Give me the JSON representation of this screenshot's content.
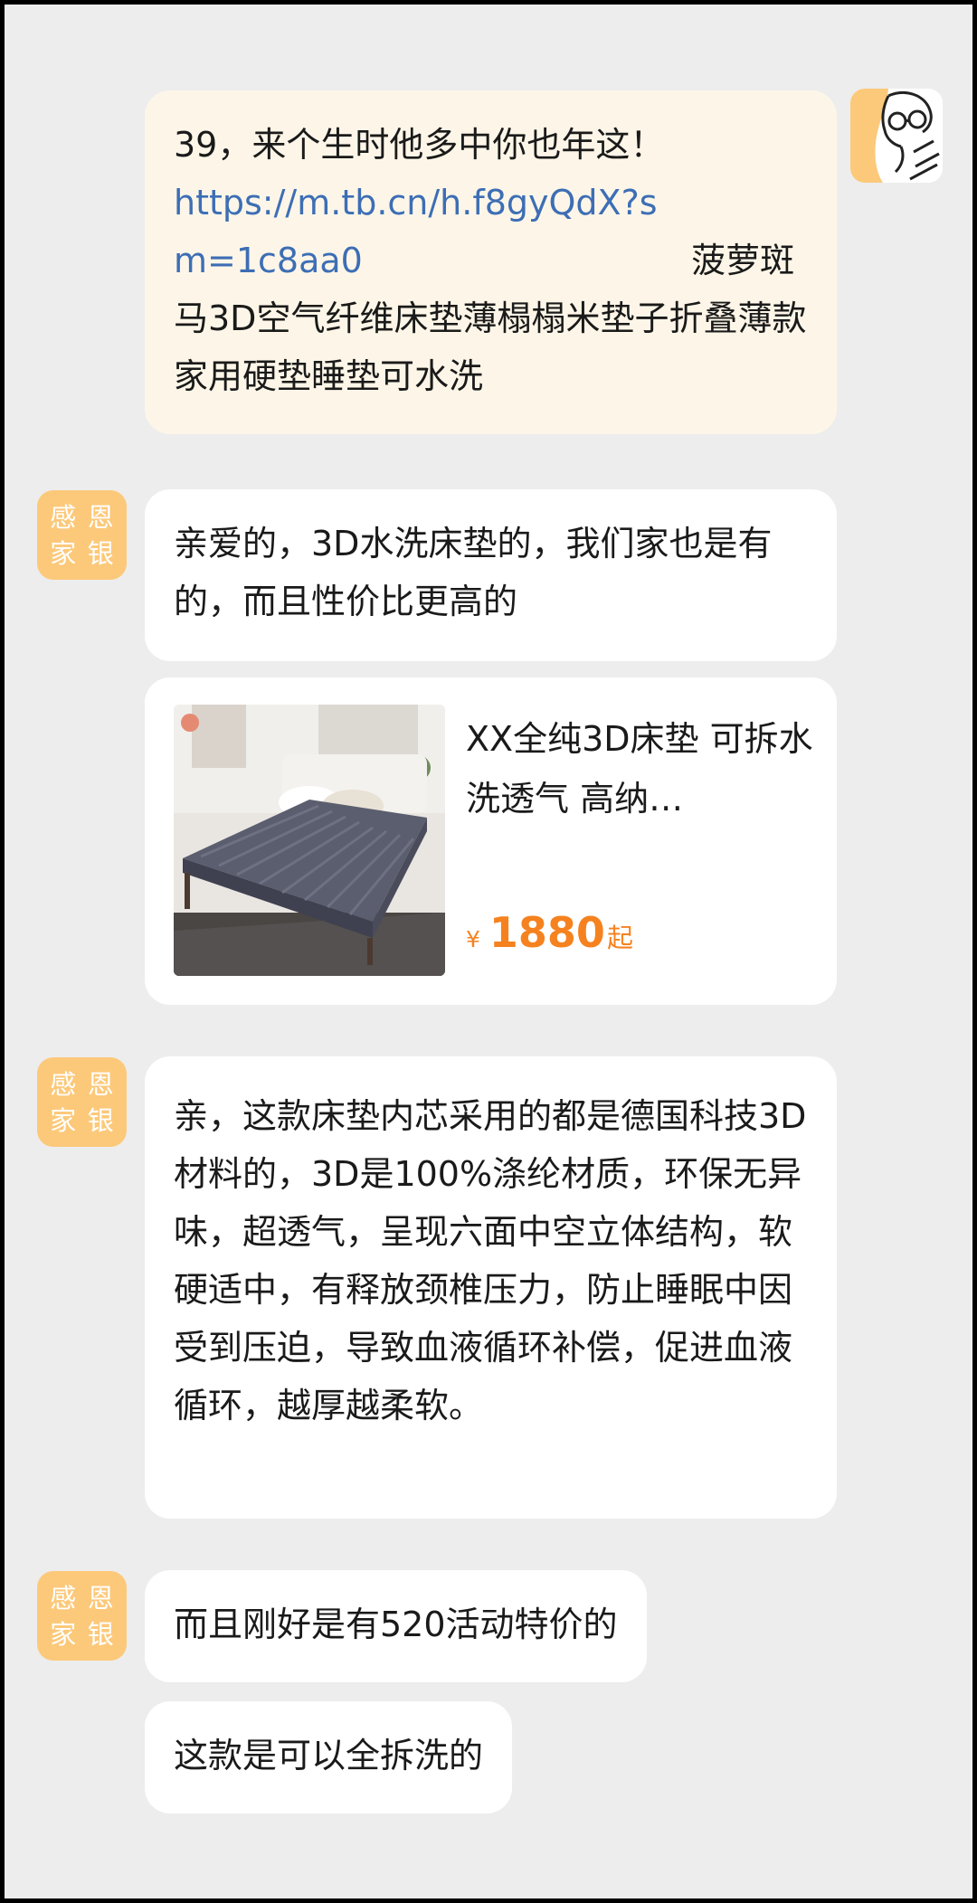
{
  "messages": {
    "user_link": {
      "intro": "39，来个生时他多中你也年这！",
      "url": "https://m.tb.cn/h.f8gyQdX?sm=1c8aa0",
      "title": "菠萝斑马3D空气纤维床垫薄榻榻米垫子折叠薄款家用硬垫睡垫可水洗"
    },
    "shop_reply_1": "亲爱的，3D水洗床垫的，我们家也是有的，而且性价比更高的",
    "product_card": {
      "title": "XX全纯3D床垫 可拆水洗透气 高纳…",
      "currency": "¥",
      "price": "1880",
      "price_suffix": "起"
    },
    "shop_reply_2": "亲，这款床垫内芯采用的都是德国科技3D材料的，3D是100%涤纶材质，环保无异味，超透气，呈现六面中空立体结构，软硬适中，有释放颈椎压力，防止睡眠中因受到压迫，导致血液循环补偿，促进血液循环，越厚越柔软。",
    "shop_reply_3": "而且刚好是有520活动特价的",
    "shop_reply_4": "这款是可以全拆洗的"
  },
  "shop_avatar": {
    "chars": [
      "感",
      "恩",
      "家",
      "银"
    ]
  },
  "user_avatar": {
    "icon": "cartoon-person-with-glasses-icon"
  },
  "colors": {
    "background": "#ededed",
    "user_bubble": "#fdf6e8",
    "link": "#3d6eb5",
    "price": "#f5821f",
    "shop_avatar": "#fcc97a"
  }
}
